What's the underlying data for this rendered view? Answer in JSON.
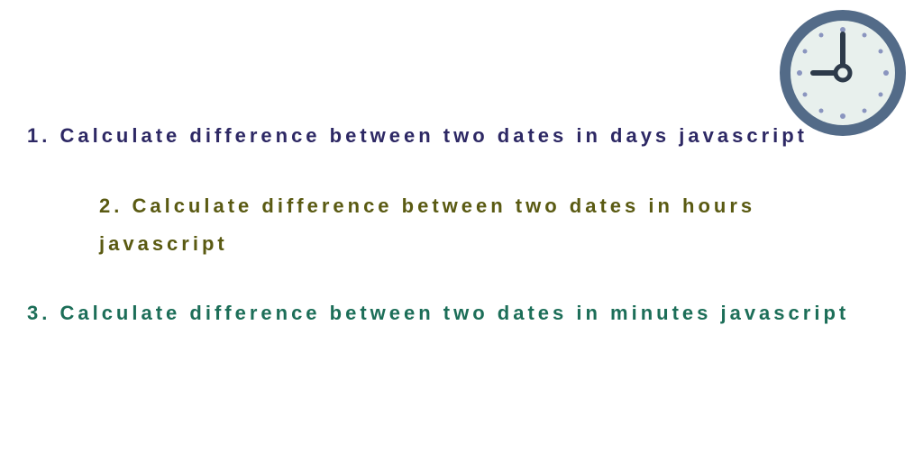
{
  "items": {
    "one": "1. Calculate difference between two dates in days javascript",
    "two": "2. Calculate difference between two dates in hours javascript",
    "three": "3. Calculate difference between two dates in minutes javascript"
  },
  "clock": {
    "name": "clock-icon",
    "rim": "#536b88",
    "face": "#e8f0ed",
    "hand": "#2d3a4a",
    "dot": "#8a95bf"
  }
}
